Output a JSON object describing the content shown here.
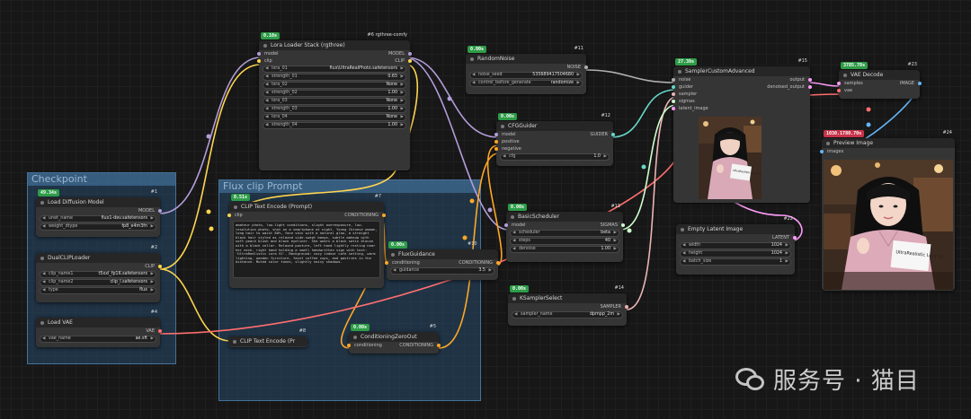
{
  "colors": {
    "model": "#b39ddb",
    "clip": "#ffd54f",
    "conditioning": "#ffa726",
    "vae": "#ff6e6e",
    "latent": "#ff9cf9",
    "image": "#64b5f6",
    "noise": "#b0b0b0",
    "guider": "#66d9c8",
    "sampler": "#ecb4b4",
    "sigmas": "#cdffcd",
    "int": "#9fd3a8"
  },
  "groups": {
    "checkpoint": "Checkpoint",
    "flux_prompt": "Flux clip Prompt"
  },
  "nodes": {
    "lora": {
      "badge": "0.10s",
      "id": "#6 rgthree-comfy",
      "title": "Lora Loader Stack (rgthree)",
      "in1": "model",
      "in2": "clip",
      "out1": "MODEL",
      "out2": "CLIP",
      "widgets": [
        [
          "lora_01",
          "flux\\UltraRealPhoto.safetensors"
        ],
        [
          "strength_01",
          "0.65"
        ],
        [
          "lora_02",
          "None"
        ],
        [
          "strength_02",
          "1.00"
        ],
        [
          "lora_03",
          "None"
        ],
        [
          "strength_03",
          "1.00"
        ],
        [
          "lora_04",
          "None"
        ],
        [
          "strength_04",
          "1.00"
        ]
      ]
    },
    "random_noise": {
      "badge": "0.00s",
      "id": "#11",
      "title": "RandomNoise",
      "out1": "NOISE",
      "widgets": [
        [
          "noise_seed",
          "535689417504680"
        ],
        [
          "control_before_generate",
          "randomize"
        ]
      ]
    },
    "sampler_adv": {
      "badge": "27.39s",
      "id": "#15",
      "title": "SamplerCustomAdvanced",
      "in1": "noise",
      "in2": "guider",
      "in3": "sampler",
      "in4": "sigmas",
      "in5": "latent_image",
      "out1": "output",
      "out2": "denoised_output"
    },
    "vae_decode": {
      "badge": "3785.70s",
      "id": "#23",
      "title": "VAE Decode",
      "in1": "samples",
      "in2": "vae",
      "out1": "IMAGE"
    },
    "preview": {
      "badge": "1030.1780.70s",
      "id": "#24",
      "title": "Preview Image",
      "in1": "images"
    },
    "cfg_guider": {
      "badge": "0.00s",
      "id": "#12",
      "title": "CFGGuider",
      "in1": "model",
      "in2": "positive",
      "in3": "negative",
      "out1": "GUIDER",
      "widgets": [
        [
          "cfg",
          "1.0"
        ]
      ]
    },
    "load_diffusion": {
      "badge": "49.34s",
      "id": "#1",
      "title": "Load Diffusion Model",
      "out1": "MODEL",
      "widgets": [
        [
          "unet_name",
          "flux1-dev.safetensors"
        ],
        [
          "weight_dtype",
          "fp8_e4m3fn"
        ]
      ]
    },
    "dual_clip": {
      "id": "#2",
      "title": "DualCLIPLoader",
      "out1": "CLIP",
      "widgets": [
        [
          "clip_name1",
          "t5xxl_fp16.safetensors"
        ],
        [
          "clip_name2",
          "clip_l.safetensors"
        ],
        [
          "type",
          "flux"
        ]
      ]
    },
    "load_vae": {
      "id": "#4",
      "title": "Load VAE",
      "out1": "VAE",
      "widgets": [
        [
          "vae_name",
          "ae.sft"
        ]
      ]
    },
    "clip_encode": {
      "badge": "0.51s",
      "id": "#7",
      "title": "CLIP Text Encode (Prompt)",
      "in1": "clip",
      "out1": "CONDITIONING",
      "text": "amateur photo, low-light conditions, slight overexposure, low-resolution photo, shot on a smartphone at night. Young Chinese woman, long hair to waist 80%, face skin with a natural glow, a straight black hair styled as relaxed side-swept bangs, subtle makeup with soft peach blush and black eyeliner. She wears a black satin blouse with a black collar. Relaxed posture, left hand lightly resting near her neck, right hand holding a small handwritten sign with text: 'UltraRealistic Lora V2'. Background: cozy indoor cafe setting, warm lighting, wooden furniture, faint coffee cups, and pastries in the distance. Muted color tones, slightly noisy shadows."
    },
    "flux_guidance": {
      "badge": "0.00s",
      "id": "#10",
      "title": "FluxGuidance",
      "in1": "conditioning",
      "out1": "CONDITIONING",
      "widgets": [
        [
          "guidance",
          "3.5"
        ]
      ]
    },
    "clip_encode2": {
      "id": "#8",
      "title": "CLIP Text Encode (Pr",
      "in1": "clip"
    },
    "cond_zero": {
      "badge": "0.00s",
      "id": "#5",
      "title": "ConditioningZeroOut",
      "in1": "conditioning",
      "out1": "CONDITIONING"
    },
    "basic_sched": {
      "badge": "0.00s",
      "id": "#13",
      "title": "BasicScheduler",
      "in1": "model",
      "out1": "SIGMAS",
      "widgets": [
        [
          "scheduler",
          "beta"
        ],
        [
          "steps",
          "40"
        ],
        [
          "denoise",
          "1.00"
        ]
      ]
    },
    "empty_latent": {
      "id": "#22",
      "title": "Empty Latent Image",
      "out1": "LATENT",
      "widgets": [
        [
          "width",
          "1024"
        ],
        [
          "height",
          "1024"
        ],
        [
          "batch_size",
          "1"
        ]
      ]
    },
    "ksampler_sel": {
      "badge": "0.00s",
      "id": "#14",
      "title": "KSamplerSelect",
      "out1": "SAMPLER",
      "widgets": [
        [
          "sampler_name",
          "dpmpp_2m"
        ]
      ]
    }
  },
  "sign_text_small": "UltraRealistic Lora V2",
  "sign_text_large": "UltraRealistic Lora V2",
  "watermark": "服务号 · 猫目"
}
